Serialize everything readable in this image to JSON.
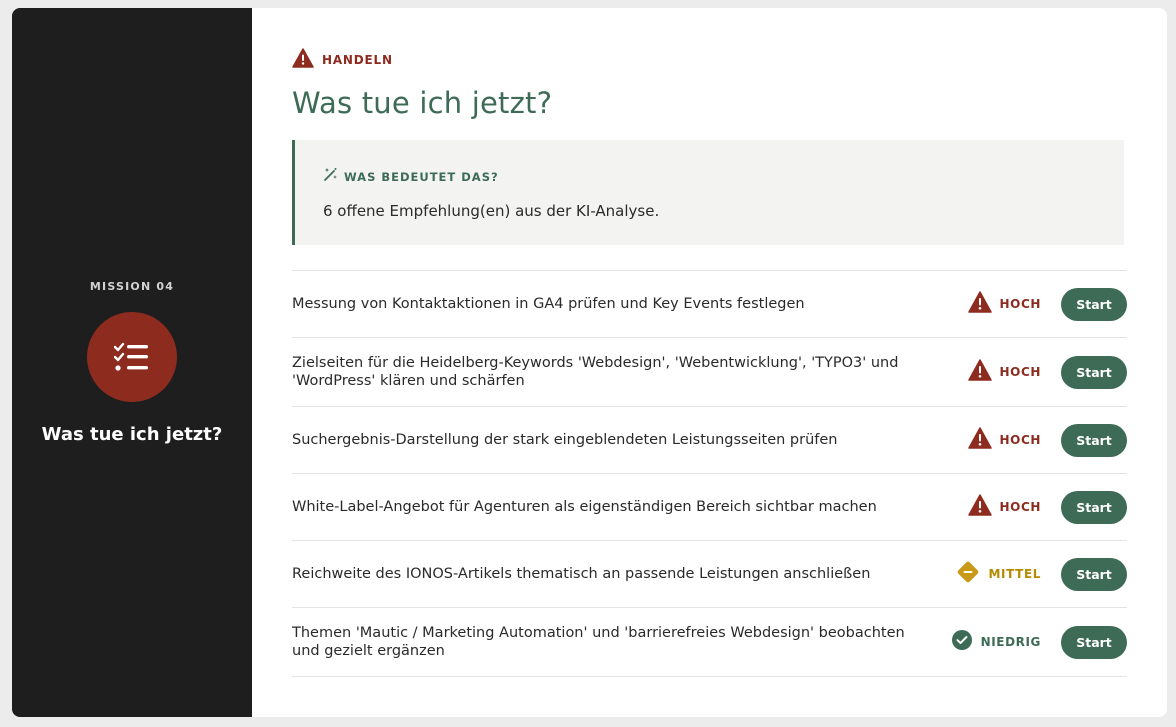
{
  "sidebar": {
    "mission_label": "MISSION 04",
    "title": "Was tue ich jetzt?",
    "icon": "checklist-icon"
  },
  "main": {
    "eyebrow": "HANDELN",
    "title": "Was tue ich jetzt?",
    "info": {
      "heading": "WAS BEDEUTET DAS?",
      "icon": "magic-wand-icon",
      "text": "6 offene Empfehlung(en) aus der KI-Analyse."
    },
    "tasks": [
      {
        "text": "Messung von Kontaktaktionen in GA4 prüfen und Key Events festlegen",
        "priority": "HOCH",
        "level": "hoch",
        "button": "Start"
      },
      {
        "text": "Zielseiten für die Heidelberg-Keywords 'Webdesign', 'Webentwicklung', 'TYPO3' und 'WordPress' klären und schärfen",
        "priority": "HOCH",
        "level": "hoch",
        "button": "Start"
      },
      {
        "text": "Suchergebnis-Darstellung der stark eingeblendeten Leistungsseiten prüfen",
        "priority": "HOCH",
        "level": "hoch",
        "button": "Start"
      },
      {
        "text": "White-Label-Angebot für Agenturen als eigenständigen Bereich sichtbar machen",
        "priority": "HOCH",
        "level": "hoch",
        "button": "Start"
      },
      {
        "text": "Reichweite des IONOS-Artikels thematisch an passende Leistungen anschließen",
        "priority": "MITTEL",
        "level": "mittel",
        "button": "Start"
      },
      {
        "text": "Themen 'Mautic / Marketing Automation' und 'barrierefreies Webdesign' beobachten und gezielt ergänzen",
        "priority": "NIEDRIG",
        "level": "niedrig",
        "button": "Start"
      }
    ]
  },
  "colors": {
    "sidebar_bg": "#1e1e1e",
    "accent_red": "#8e2b1f",
    "accent_green": "#3d6b55",
    "accent_gold": "#c89a17"
  }
}
